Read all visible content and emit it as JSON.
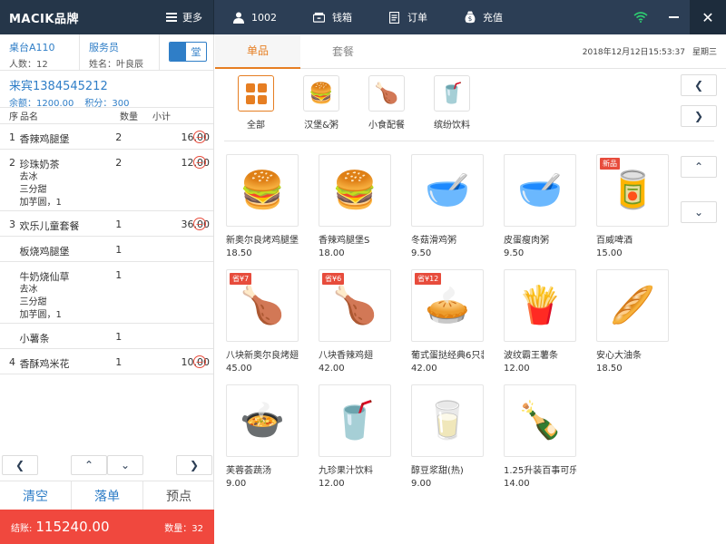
{
  "topbar": {
    "brand": "MACIK品牌",
    "more": "更多",
    "user": "1002",
    "cashbox": "钱箱",
    "orders": "订单",
    "recharge": "充值"
  },
  "left": {
    "table_label": "桌台A110",
    "people": "人数：12",
    "waiter_label": "服务员",
    "waiter_name": "姓名：叶良辰",
    "dine_mode": "堂",
    "member_title": "来宾1384545212",
    "balance": "余额：1200.00",
    "points": "积分：300",
    "headers": {
      "no": "序",
      "name": "品名",
      "qty": "数量",
      "subtotal": "小计"
    },
    "rows": [
      {
        "no": "1",
        "name": "香辣鸡腿堡",
        "qty": "2",
        "subtotal": "16.00",
        "notes": []
      },
      {
        "no": "2",
        "name": "珍珠奶茶",
        "qty": "2",
        "subtotal": "12.00",
        "notes": [
          "去冰",
          "三分甜",
          "加芋圆，1"
        ]
      },
      {
        "no": "3",
        "name": "欢乐儿童套餐",
        "qty": "1",
        "subtotal": "36.00",
        "notes": []
      },
      {
        "no": "",
        "name": "板烧鸡腿堡",
        "qty": "1",
        "subtotal": "",
        "notes": []
      },
      {
        "no": "",
        "name": "牛奶烧仙草",
        "qty": "1",
        "subtotal": "",
        "notes": [
          "去冰",
          "三分甜",
          "加芋圆，1"
        ]
      },
      {
        "no": "",
        "name": "小薯条",
        "qty": "1",
        "subtotal": "",
        "notes": []
      },
      {
        "no": "4",
        "name": "香酥鸡米花",
        "qty": "1",
        "subtotal": "10.00",
        "notes": []
      }
    ],
    "actions": {
      "clear": "清空",
      "submit": "落单",
      "preorder": "预点"
    },
    "total_label": "结账:",
    "total_amount": "115240.00",
    "count_label": "数量：32"
  },
  "right": {
    "tabs": [
      "单品",
      "套餐"
    ],
    "datetime": "2018年12月12日15:53:37",
    "weekday": "星期三",
    "categories": [
      {
        "label": "全部",
        "icon": "grid-icon"
      },
      {
        "label": "汉堡&粥",
        "icon": "burger-icon"
      },
      {
        "label": "小食配餐",
        "icon": "chicken-icon"
      },
      {
        "label": "缤纷饮料",
        "icon": "drink-icon"
      }
    ],
    "products": [
      [
        {
          "name": "新奥尔良烤鸡腿堡S",
          "price": "18.50",
          "badge": "",
          "icon": "🍔"
        },
        {
          "name": "香辣鸡腿堡S",
          "price": "18.00",
          "badge": "",
          "icon": "🍔"
        },
        {
          "name": "冬菇滑鸡粥",
          "price": "9.50",
          "badge": "",
          "icon": "🥣"
        },
        {
          "name": "皮蛋瘦肉粥",
          "price": "9.50",
          "badge": "",
          "icon": "🥣"
        },
        {
          "name": "百威啤酒",
          "price": "15.00",
          "badge": "新品",
          "icon": "🥫"
        }
      ],
      [
        {
          "name": "八块新奥尔良烤翅",
          "price": "45.00",
          "badge": "省¥7",
          "icon": "🍗"
        },
        {
          "name": "八块香辣鸡翅",
          "price": "42.00",
          "badge": "省¥6",
          "icon": "🍗"
        },
        {
          "name": "葡式蛋挞经典6只装",
          "price": "42.00",
          "badge": "省¥12",
          "icon": "🥧"
        },
        {
          "name": "波纹霸王薯条",
          "price": "12.00",
          "badge": "",
          "icon": "🍟"
        },
        {
          "name": "安心大油条",
          "price": "18.50",
          "badge": "",
          "icon": "🥖"
        }
      ],
      [
        {
          "name": "芙蓉荟蔬汤",
          "price": "9.00",
          "badge": "",
          "icon": "🍲"
        },
        {
          "name": "九珍果汁饮料",
          "price": "12.00",
          "badge": "",
          "icon": "🥤"
        },
        {
          "name": "醇豆浆甜(热)",
          "price": "9.00",
          "badge": "",
          "icon": "🥛"
        },
        {
          "name": "1.25升装百事可乐",
          "price": "14.00",
          "badge": "",
          "icon": "🍾"
        }
      ]
    ]
  }
}
